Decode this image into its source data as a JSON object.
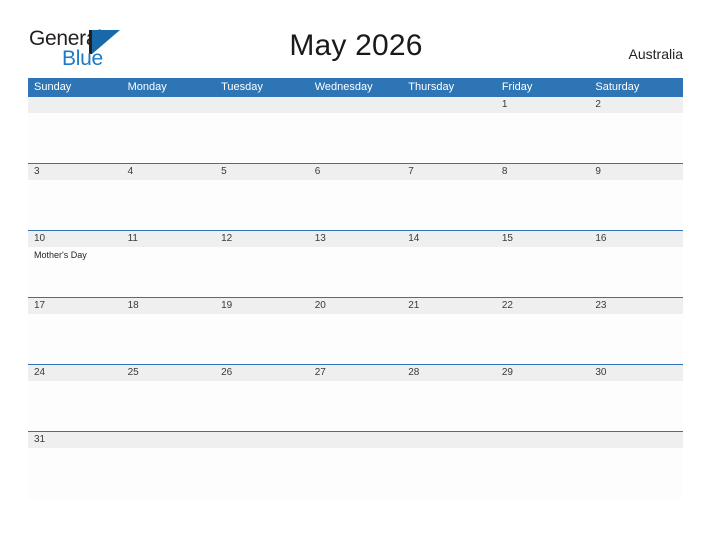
{
  "brand": {
    "name_part1": "General",
    "name_part2": "Blue",
    "logo_icon": "sail-triangle-icon",
    "accent_color": "#1f7ac4"
  },
  "header": {
    "title": "May 2026",
    "region": "Australia"
  },
  "theme": {
    "header_blue": "#2e75b6",
    "row_separator_blue": "#2e75b6",
    "daynum_band_gray": "#efefef",
    "cell_background": "#fdfdfd",
    "title_color": "#1a1a1a"
  },
  "calendar": {
    "month": "May",
    "year": "2026",
    "weekday_headers": [
      "Sunday",
      "Monday",
      "Tuesday",
      "Wednesday",
      "Thursday",
      "Friday",
      "Saturday"
    ],
    "weeks": [
      {
        "days": [
          {
            "num": "",
            "event": ""
          },
          {
            "num": "",
            "event": ""
          },
          {
            "num": "",
            "event": ""
          },
          {
            "num": "",
            "event": ""
          },
          {
            "num": "",
            "event": ""
          },
          {
            "num": "1",
            "event": ""
          },
          {
            "num": "2",
            "event": ""
          }
        ]
      },
      {
        "days": [
          {
            "num": "3",
            "event": ""
          },
          {
            "num": "4",
            "event": ""
          },
          {
            "num": "5",
            "event": ""
          },
          {
            "num": "6",
            "event": ""
          },
          {
            "num": "7",
            "event": ""
          },
          {
            "num": "8",
            "event": ""
          },
          {
            "num": "9",
            "event": ""
          }
        ]
      },
      {
        "days": [
          {
            "num": "10",
            "event": "Mother's Day"
          },
          {
            "num": "11",
            "event": ""
          },
          {
            "num": "12",
            "event": ""
          },
          {
            "num": "13",
            "event": ""
          },
          {
            "num": "14",
            "event": ""
          },
          {
            "num": "15",
            "event": ""
          },
          {
            "num": "16",
            "event": ""
          }
        ]
      },
      {
        "days": [
          {
            "num": "17",
            "event": ""
          },
          {
            "num": "18",
            "event": ""
          },
          {
            "num": "19",
            "event": ""
          },
          {
            "num": "20",
            "event": ""
          },
          {
            "num": "21",
            "event": ""
          },
          {
            "num": "22",
            "event": ""
          },
          {
            "num": "23",
            "event": ""
          }
        ]
      },
      {
        "days": [
          {
            "num": "24",
            "event": ""
          },
          {
            "num": "25",
            "event": ""
          },
          {
            "num": "26",
            "event": ""
          },
          {
            "num": "27",
            "event": ""
          },
          {
            "num": "28",
            "event": ""
          },
          {
            "num": "29",
            "event": ""
          },
          {
            "num": "30",
            "event": ""
          }
        ]
      },
      {
        "days": [
          {
            "num": "31",
            "event": ""
          },
          {
            "num": "",
            "event": ""
          },
          {
            "num": "",
            "event": ""
          },
          {
            "num": "",
            "event": ""
          },
          {
            "num": "",
            "event": ""
          },
          {
            "num": "",
            "event": ""
          },
          {
            "num": "",
            "event": ""
          }
        ]
      }
    ]
  }
}
